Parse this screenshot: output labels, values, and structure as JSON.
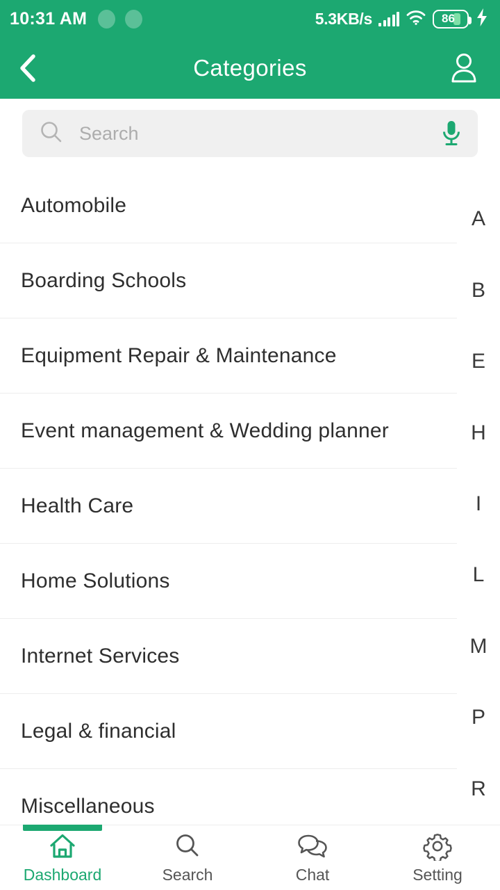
{
  "statusbar": {
    "time": "10:31 AM",
    "network_speed": "5.3KB/s",
    "battery_level": "86",
    "icons": [
      "notification-dot-icon",
      "notification-dot-icon",
      "signal-bars-icon",
      "wifi-icon",
      "battery-icon",
      "charging-bolt-icon"
    ]
  },
  "appbar": {
    "title": "Categories",
    "back_icon": "chevron-left-icon",
    "profile_icon": "person-icon"
  },
  "search": {
    "placeholder": "Search",
    "value": "",
    "search_icon": "search-icon",
    "mic_icon": "microphone-icon"
  },
  "categories": [
    {
      "label": "Automobile"
    },
    {
      "label": "Boarding Schools"
    },
    {
      "label": "Equipment Repair & Maintenance"
    },
    {
      "label": "Event management & Wedding planner"
    },
    {
      "label": "Health Care"
    },
    {
      "label": "Home Solutions"
    },
    {
      "label": "Internet Services"
    },
    {
      "label": "Legal & financial"
    },
    {
      "label": "Miscellaneous"
    }
  ],
  "alpha_index": [
    "A",
    "B",
    "E",
    "H",
    "I",
    "L",
    "M",
    "P",
    "R"
  ],
  "bottomnav": {
    "items": [
      {
        "label": "Dashboard",
        "icon": "home-icon",
        "active": true
      },
      {
        "label": "Search",
        "icon": "search-icon",
        "active": false
      },
      {
        "label": "Chat",
        "icon": "chat-bubbles-icon",
        "active": false
      },
      {
        "label": "Setting",
        "icon": "gear-icon",
        "active": false
      }
    ]
  },
  "colors": {
    "brand_green": "#1CA871",
    "text_dark": "#2E2E2E",
    "text_muted": "#555555",
    "divider": "#EDEDED",
    "search_bg": "#F0F0F0",
    "placeholder": "#ADADAD"
  }
}
